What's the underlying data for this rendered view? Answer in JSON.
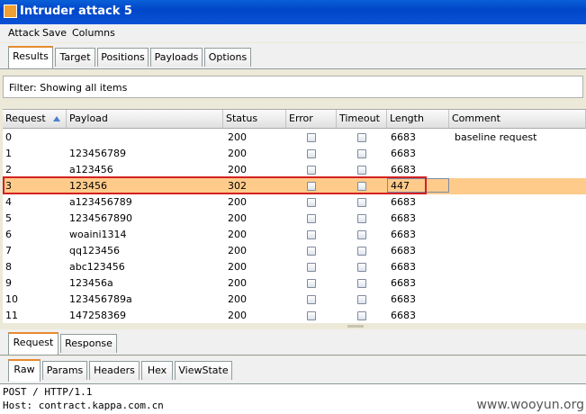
{
  "window": {
    "title": "Intruder attack 5"
  },
  "menu": [
    "Attack",
    "Save",
    "Columns"
  ],
  "tabs": [
    "Results",
    "Target",
    "Positions",
    "Payloads",
    "Options"
  ],
  "filter": {
    "text": "Filter:  Showing all items"
  },
  "table": {
    "columns": [
      "Request",
      "Payload",
      "Status",
      "Error",
      "Timeout",
      "Length",
      "Comment"
    ],
    "rows": [
      {
        "request": "0",
        "payload": "",
        "status": "200",
        "length": "6683",
        "comment": "baseline request"
      },
      {
        "request": "1",
        "payload": "123456789",
        "status": "200",
        "length": "6683",
        "comment": ""
      },
      {
        "request": "2",
        "payload": "a123456",
        "status": "200",
        "length": "6683",
        "comment": ""
      },
      {
        "request": "3",
        "payload": "123456",
        "status": "302",
        "length": "447",
        "comment": ""
      },
      {
        "request": "4",
        "payload": "a123456789",
        "status": "200",
        "length": "6683",
        "comment": ""
      },
      {
        "request": "5",
        "payload": "1234567890",
        "status": "200",
        "length": "6683",
        "comment": ""
      },
      {
        "request": "6",
        "payload": "woaini1314",
        "status": "200",
        "length": "6683",
        "comment": ""
      },
      {
        "request": "7",
        "payload": "qq123456",
        "status": "200",
        "length": "6683",
        "comment": ""
      },
      {
        "request": "8",
        "payload": "abc123456",
        "status": "200",
        "length": "6683",
        "comment": ""
      },
      {
        "request": "9",
        "payload": "123456a",
        "status": "200",
        "length": "6683",
        "comment": ""
      },
      {
        "request": "10",
        "payload": "123456789a",
        "status": "200",
        "length": "6683",
        "comment": ""
      },
      {
        "request": "11",
        "payload": "147258369",
        "status": "200",
        "length": "6683",
        "comment": ""
      }
    ]
  },
  "lower_tabs": [
    "Request",
    "Response"
  ],
  "view_tabs": [
    "Raw",
    "Params",
    "Headers",
    "Hex",
    "ViewState"
  ],
  "editor": {
    "lines": [
      "POST / HTTP/1.1",
      "Host: contract.kappa.com.cn"
    ]
  },
  "watermark": "www.wooyun.org",
  "colors": {
    "selected_row": "#fecb8b",
    "highlight_box": "#d42020",
    "active_tab_accent": "#e68b2c"
  }
}
